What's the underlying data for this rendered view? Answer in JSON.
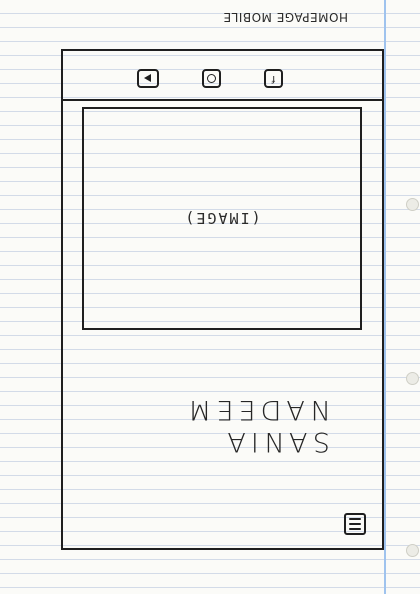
{
  "page": {
    "caption": "HOMEPAGE MOBILE"
  },
  "header": {
    "menu_icon": "hamburger-menu-icon"
  },
  "hero": {
    "name_line1": "SANIA",
    "name_line2": "NADEEM"
  },
  "image_placeholder": {
    "label": "(IMAGE)"
  },
  "footer": {
    "icons": [
      "facebook-icon",
      "instagram-icon",
      "youtube-icon"
    ],
    "facebook_glyph": "f"
  }
}
